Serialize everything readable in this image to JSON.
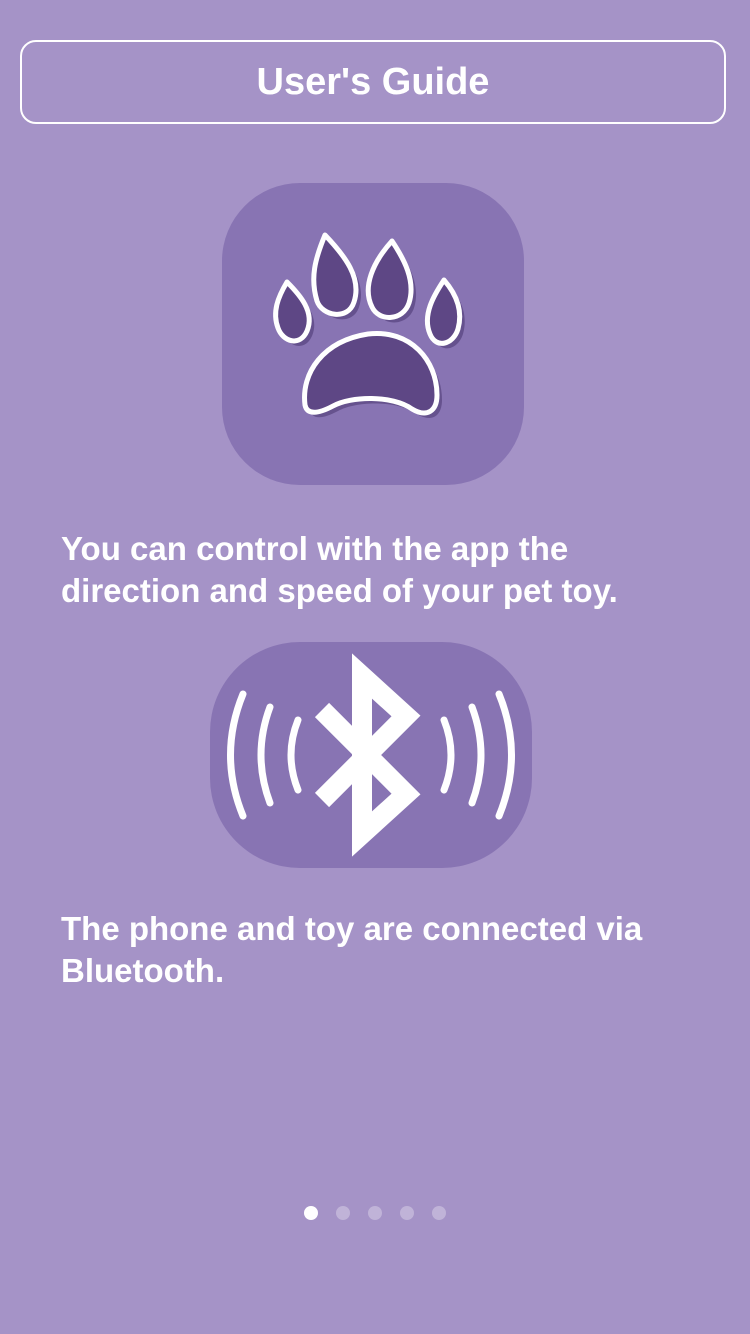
{
  "header": {
    "title": "User's Guide"
  },
  "steps": [
    {
      "icon": "paw-icon",
      "text": "You can control with the app the direction and speed of your pet toy."
    },
    {
      "icon": "bluetooth-icon",
      "text": "The phone and toy are connected via Bluetooth."
    }
  ],
  "pager": {
    "current_page": 1,
    "total_pages": 5
  },
  "colors": {
    "background": "#a593c7",
    "tile": "#8874b3",
    "paw_fill": "#5e4785",
    "foreground": "#ffffff"
  }
}
